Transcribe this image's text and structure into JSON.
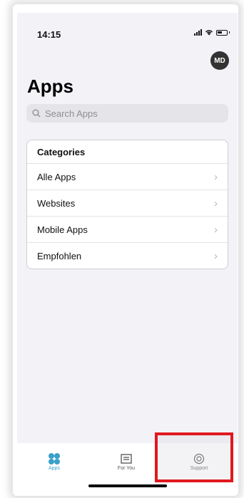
{
  "status_bar": {
    "time": "14:15"
  },
  "header": {
    "avatar_initials": "MD",
    "title": "Apps"
  },
  "search": {
    "placeholder": "Search Apps",
    "value": ""
  },
  "categories": {
    "heading": "Categories",
    "items": [
      {
        "label": "Alle Apps"
      },
      {
        "label": "Websites"
      },
      {
        "label": "Mobile Apps"
      },
      {
        "label": "Empfohlen"
      }
    ]
  },
  "tabbar": {
    "tabs": [
      {
        "label": "Apps",
        "icon": "apps-grid-icon",
        "active": true
      },
      {
        "label": "For You",
        "icon": "for-you-icon",
        "active": false
      },
      {
        "label": "Support",
        "icon": "support-icon",
        "active": false
      }
    ]
  },
  "colors": {
    "accent": "#3aa0c8",
    "highlight": "#e0191e",
    "background": "#f2f2f7"
  }
}
